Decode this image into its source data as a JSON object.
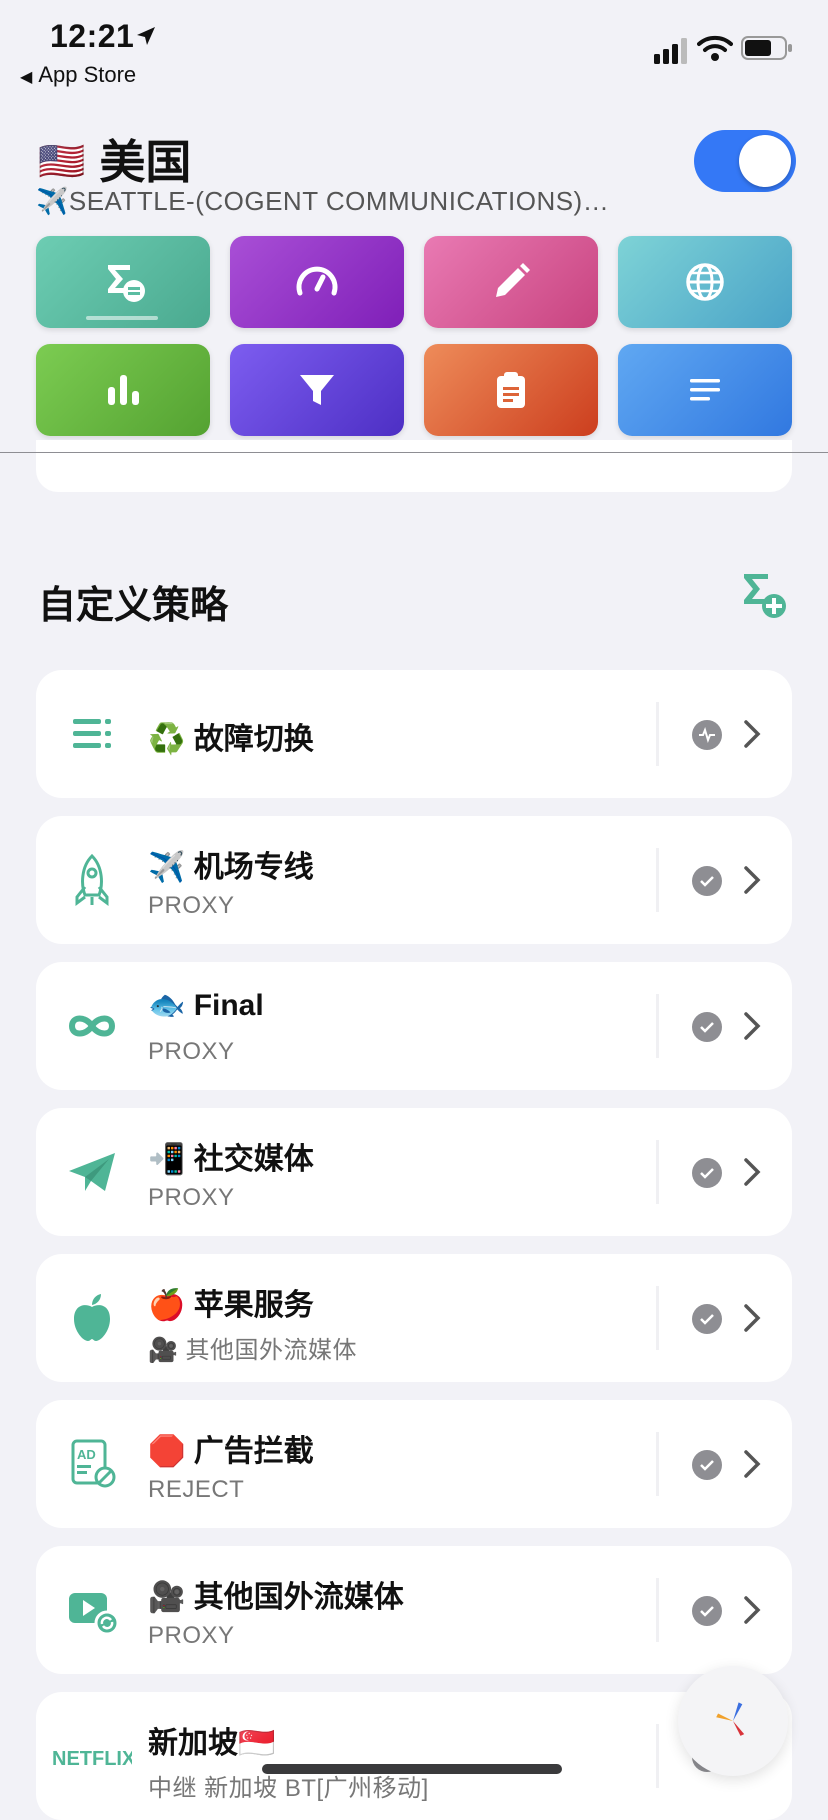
{
  "status_bar": {
    "time": "12:21",
    "back_label": "App Store"
  },
  "header": {
    "flag": "🇺🇸",
    "title": "美国",
    "subtitle": "✈️SEATTLE-(COGENT COMMUNICATIONS)…",
    "toggle_on": true
  },
  "tiles": [
    {
      "icon": "sigma-list-icon",
      "color_from": "#6dcdb3",
      "color_to": "#4aa98f"
    },
    {
      "icon": "speedometer-icon",
      "color_from": "#a94fd6",
      "color_to": "#7f1fb8"
    },
    {
      "icon": "pencil-icon",
      "color_from": "#e97ab3",
      "color_to": "#c8437f"
    },
    {
      "icon": "globe-icon",
      "color_from": "#7ed3d6",
      "color_to": "#4aa3c8"
    },
    {
      "icon": "bar-chart-icon",
      "color_from": "#7ccc52",
      "color_to": "#54a231"
    },
    {
      "icon": "filter-icon",
      "color_from": "#7d5df0",
      "color_to": "#4d2fc4"
    },
    {
      "icon": "clipboard-icon",
      "color_from": "#ee8c5a",
      "color_to": "#cc3e1e"
    },
    {
      "icon": "text-lines-icon",
      "color_from": "#60a8f2",
      "color_to": "#3178e0"
    }
  ],
  "section": {
    "title": "自定义策略"
  },
  "policies": [
    {
      "icon": "list-icon",
      "name": "♻️ 故障切换",
      "sub": "",
      "status": "activity"
    },
    {
      "icon": "rocket-icon",
      "name": "✈️ 机场专线",
      "sub": "PROXY",
      "status": "check"
    },
    {
      "icon": "infinity-icon",
      "name": "🐟 Final",
      "sub": "PROXY",
      "status": "check"
    },
    {
      "icon": "paper-plane-icon",
      "name": "📲 社交媒体",
      "sub": "PROXY",
      "status": "check"
    },
    {
      "icon": "apple-icon",
      "name": "🍎 苹果服务",
      "sub": "🎥 其他国外流媒体",
      "status": "check"
    },
    {
      "icon": "ad-block-icon",
      "name": "🛑 广告拦截",
      "sub": "REJECT",
      "status": "check"
    },
    {
      "icon": "video-icon",
      "name": "🎥 其他国外流媒体",
      "sub": "PROXY",
      "status": "check"
    },
    {
      "icon": "netflix-icon",
      "name": "新加坡🇸🇬",
      "sub": "中继 新加坡 BT[广州移动]",
      "status": "check",
      "logo_text": "NETFLIX"
    }
  ],
  "accent": "#4fb596"
}
